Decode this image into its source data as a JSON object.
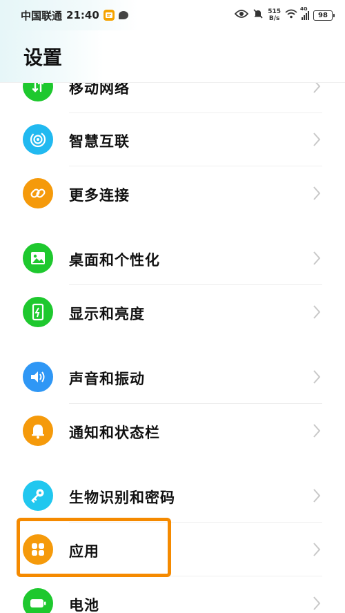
{
  "status_bar": {
    "carrier": "中国联通",
    "time": "21:40",
    "speed_value": "515",
    "speed_unit": "B/s",
    "network": "4G",
    "battery": "98"
  },
  "header": {
    "title": "设置"
  },
  "settings": {
    "items": [
      {
        "label": "移动网络",
        "icon": "mobile-network-icon",
        "color": "#1ec82e"
      },
      {
        "label": "智慧互联",
        "icon": "smart-connect-icon",
        "color": "#21b9f0"
      },
      {
        "label": "更多连接",
        "icon": "link-icon",
        "color": "#f59a0b"
      },
      {
        "label": "桌面和个性化",
        "icon": "image-icon",
        "color": "#1ec82e"
      },
      {
        "label": "显示和亮度",
        "icon": "brightness-icon",
        "color": "#1ec82e"
      },
      {
        "label": "声音和振动",
        "icon": "speaker-icon",
        "color": "#2f97f5"
      },
      {
        "label": "通知和状态栏",
        "icon": "bell-icon",
        "color": "#f59a0b"
      },
      {
        "label": "生物识别和密码",
        "icon": "key-icon",
        "color": "#21c7ef"
      },
      {
        "label": "应用",
        "icon": "apps-grid-icon",
        "color": "#f59a0b"
      },
      {
        "label": "电池",
        "icon": "battery-icon",
        "color": "#1ec82e"
      }
    ]
  },
  "highlight_color": "#f58a00"
}
